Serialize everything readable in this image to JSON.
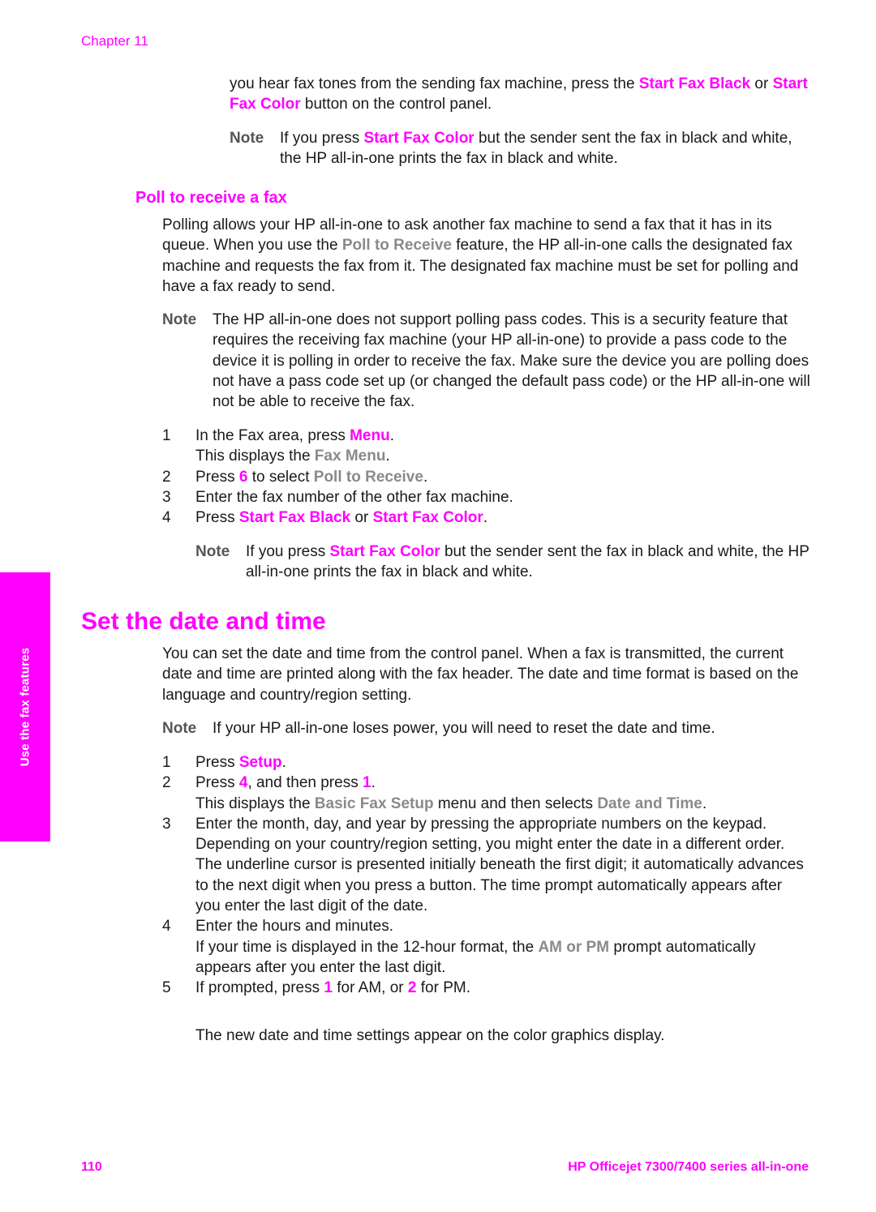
{
  "header": {
    "chapter": "Chapter 11"
  },
  "side_tab": {
    "label": "Use the fax features"
  },
  "intro": {
    "p1": [
      {
        "t": "you hear fax tones from the sending fax machine, press the "
      },
      {
        "t": "Start Fax Black",
        "s": "pink"
      },
      {
        "t": " or "
      },
      {
        "t": "Start Fax Color",
        "s": "pink"
      },
      {
        "t": " button on the control panel."
      }
    ],
    "note_label": "Note",
    "note": [
      {
        "t": "If you press "
      },
      {
        "t": "Start Fax Color",
        "s": "pink"
      },
      {
        "t": " but the sender sent the fax in black and white, the HP all-in-one prints the fax in black and white."
      }
    ]
  },
  "poll_section": {
    "heading": "Poll to receive a fax",
    "p1": [
      {
        "t": "Polling allows your HP all-in-one to ask another fax machine to send a fax that it has in its queue. When you use the "
      },
      {
        "t": "Poll to Receive",
        "s": "grey"
      },
      {
        "t": " feature, the HP all-in-one calls the designated fax machine and requests the fax from it. The designated fax machine must be set for polling and have a fax ready to send."
      }
    ],
    "note_label": "Note",
    "note": [
      {
        "t": "The HP all-in-one does not support polling pass codes. This is a security feature that requires the receiving fax machine (your HP all-in-one) to provide a pass code to the device it is polling in order to receive the fax. Make sure the device you are polling does not have a pass code set up (or changed the default pass code) or the HP all-in-one will not be able to receive the fax."
      }
    ],
    "steps": [
      {
        "num": "1",
        "body": [
          {
            "t": "In the Fax area, press "
          },
          {
            "t": "Menu",
            "s": "pink"
          },
          {
            "t": "."
          },
          {
            "br": true
          },
          {
            "t": "This displays the "
          },
          {
            "t": "Fax Menu",
            "s": "grey"
          },
          {
            "t": "."
          }
        ]
      },
      {
        "num": "2",
        "body": [
          {
            "t": "Press "
          },
          {
            "t": "6",
            "s": "pink"
          },
          {
            "t": " to select "
          },
          {
            "t": "Poll to Receive",
            "s": "grey"
          },
          {
            "t": "."
          }
        ]
      },
      {
        "num": "3",
        "body": [
          {
            "t": "Enter the fax number of the other fax machine."
          }
        ]
      },
      {
        "num": "4",
        "body": [
          {
            "t": "Press "
          },
          {
            "t": "Start Fax Black",
            "s": "pink"
          },
          {
            "t": " or "
          },
          {
            "t": "Start Fax Color",
            "s": "pink"
          },
          {
            "t": "."
          }
        ]
      }
    ],
    "step_note_label": "Note",
    "step_note": [
      {
        "t": "If you press "
      },
      {
        "t": "Start Fax Color",
        "s": "pink"
      },
      {
        "t": " but the sender sent the fax in black and white, the HP all-in-one prints the fax in black and white."
      }
    ]
  },
  "date_section": {
    "heading": "Set the date and time",
    "p1": [
      {
        "t": "You can set the date and time from the control panel. When a fax is transmitted, the current date and time are printed along with the fax header. The date and time format is based on the language and country/region setting."
      }
    ],
    "note_label": "Note",
    "note": [
      {
        "t": "If your HP all-in-one loses power, you will need to reset the date and time."
      }
    ],
    "steps": [
      {
        "num": "1",
        "body": [
          {
            "t": "Press "
          },
          {
            "t": "Setup",
            "s": "pink"
          },
          {
            "t": "."
          }
        ]
      },
      {
        "num": "2",
        "body": [
          {
            "t": "Press "
          },
          {
            "t": "4",
            "s": "pink"
          },
          {
            "t": ", and then press "
          },
          {
            "t": "1",
            "s": "pink"
          },
          {
            "t": "."
          },
          {
            "br": true
          },
          {
            "t": "This displays the "
          },
          {
            "t": "Basic Fax Setup",
            "s": "grey"
          },
          {
            "t": " menu and then selects "
          },
          {
            "t": "Date and Time",
            "s": "grey"
          },
          {
            "t": "."
          }
        ]
      },
      {
        "num": "3",
        "body": [
          {
            "t": "Enter the month, day, and year by pressing the appropriate numbers on the keypad. Depending on your country/region setting, you might enter the date in a different order."
          },
          {
            "br": true
          },
          {
            "t": "The underline cursor is presented initially beneath the first digit; it automatically advances to the next digit when you press a button. The time prompt automatically appears after you enter the last digit of the date."
          }
        ]
      },
      {
        "num": "4",
        "body": [
          {
            "t": "Enter the hours and minutes."
          },
          {
            "br": true
          },
          {
            "t": "If your time is displayed in the 12-hour format, the "
          },
          {
            "t": "AM or PM",
            "s": "grey"
          },
          {
            "t": " prompt automatically appears after you enter the last digit."
          }
        ]
      },
      {
        "num": "5",
        "body": [
          {
            "t": "If prompted, press "
          },
          {
            "t": "1",
            "s": "pink"
          },
          {
            "t": " for AM, or "
          },
          {
            "t": "2",
            "s": "pink"
          },
          {
            "t": " for PM."
          }
        ]
      }
    ],
    "closing": [
      {
        "t": "The new date and time settings appear on the color graphics display."
      }
    ]
  },
  "footer": {
    "page_number": "110",
    "product": "HP Officejet 7300/7400 series all-in-one"
  },
  "colors": {
    "accent": "#ff00ff",
    "ui_term": "#8a8a8a",
    "text": "#1a1a1a"
  }
}
